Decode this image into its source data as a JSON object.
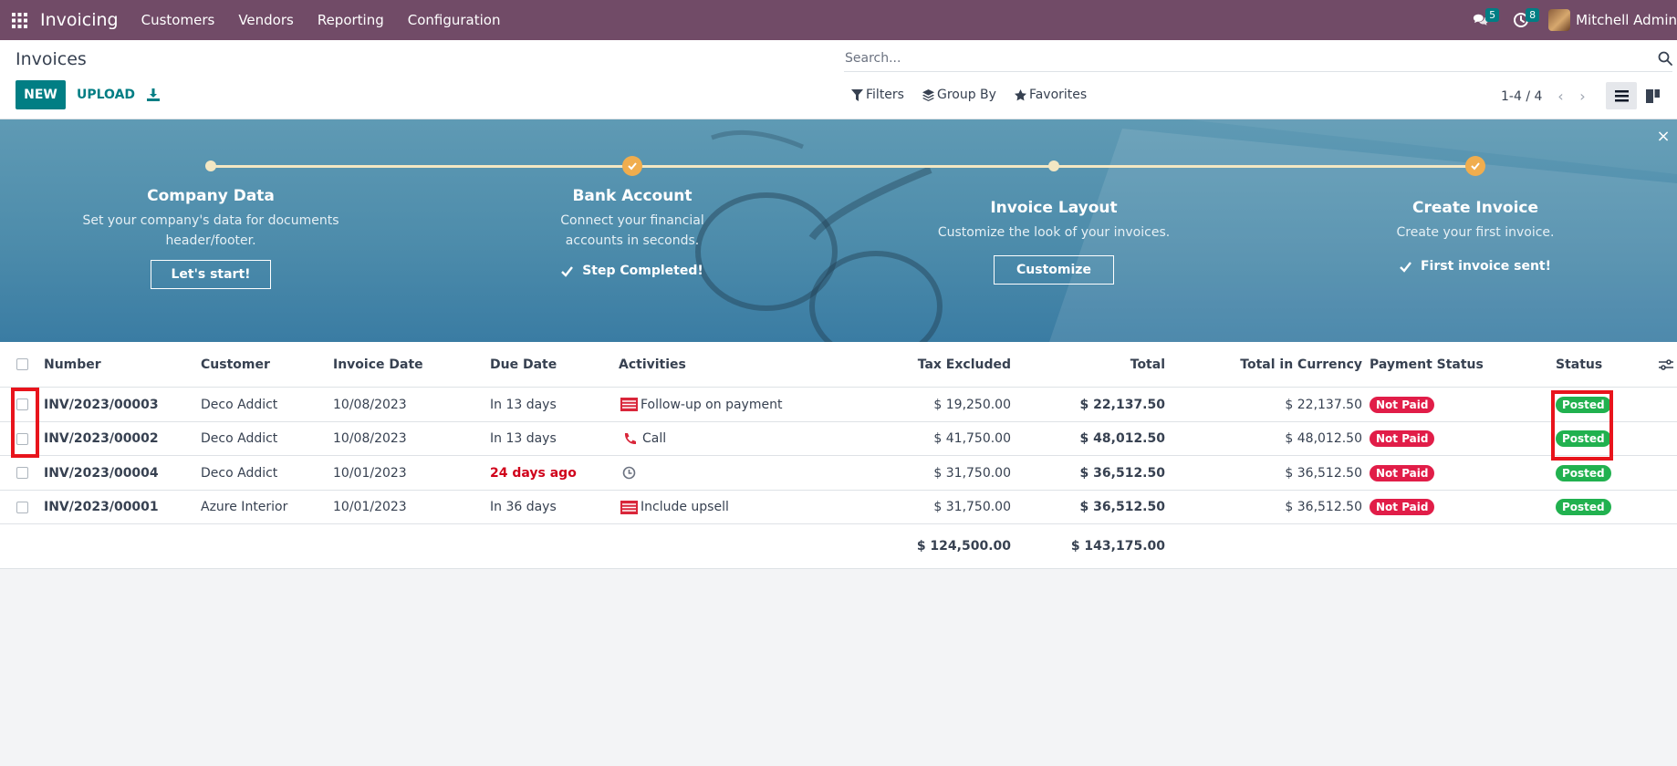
{
  "navbar": {
    "app_name": "Invoicing",
    "menu": [
      "Customers",
      "Vendors",
      "Reporting",
      "Configuration"
    ],
    "messages_count": "5",
    "activities_count": "8",
    "user_name": "Mitchell Admin"
  },
  "control": {
    "title": "Invoices",
    "new_label": "NEW",
    "upload_label": "UPLOAD",
    "search_placeholder": "Search...",
    "filters_label": "Filters",
    "groupby_label": "Group By",
    "favorites_label": "Favorites",
    "pager": "1-4 / 4"
  },
  "onboarding": {
    "close": "×",
    "steps": [
      {
        "title": "Company Data",
        "desc": "Set your company's data for documents header/footer.",
        "action": "Let's start!",
        "done": false
      },
      {
        "title": "Bank Account",
        "desc": "Connect your financial accounts in seconds.",
        "action": "Step Completed!",
        "done": true
      },
      {
        "title": "Invoice Layout",
        "desc": "Customize the look of your invoices.",
        "action": "Customize",
        "done": false
      },
      {
        "title": "Create Invoice",
        "desc": "Create your first invoice.",
        "action": "First invoice sent!",
        "done": true
      }
    ]
  },
  "table": {
    "columns": [
      "Number",
      "Customer",
      "Invoice Date",
      "Due Date",
      "Activities",
      "Tax Excluded",
      "Total",
      "Total in Currency",
      "Payment Status",
      "Status"
    ],
    "rows": [
      {
        "number": "INV/2023/00003",
        "customer": "Deco Addict",
        "invoice_date": "10/08/2023",
        "due_date": "In 13 days",
        "due_overdue": false,
        "activity_icon": "email-icon",
        "activity": "Follow-up on payment",
        "tax_excluded": "$ 19,250.00",
        "total": "$ 22,137.50",
        "total_currency": "$ 22,137.50",
        "payment_status": "Not Paid",
        "status": "Posted"
      },
      {
        "number": "INV/2023/00002",
        "customer": "Deco Addict",
        "invoice_date": "10/08/2023",
        "due_date": "In 13 days",
        "due_overdue": false,
        "activity_icon": "phone-icon",
        "activity": "Call",
        "tax_excluded": "$ 41,750.00",
        "total": "$ 48,012.50",
        "total_currency": "$ 48,012.50",
        "payment_status": "Not Paid",
        "status": "Posted"
      },
      {
        "number": "INV/2023/00004",
        "customer": "Deco Addict",
        "invoice_date": "10/01/2023",
        "due_date": "24 days ago",
        "due_overdue": true,
        "activity_icon": "clock-icon",
        "activity": "",
        "tax_excluded": "$ 31,750.00",
        "total": "$ 36,512.50",
        "total_currency": "$ 36,512.50",
        "payment_status": "Not Paid",
        "status": "Posted"
      },
      {
        "number": "INV/2023/00001",
        "customer": "Azure Interior",
        "invoice_date": "10/01/2023",
        "due_date": "In 36 days",
        "due_overdue": false,
        "activity_icon": "email-icon",
        "activity": "Include upsell",
        "tax_excluded": "$ 31,750.00",
        "total": "$ 36,512.50",
        "total_currency": "$ 36,512.50",
        "payment_status": "Not Paid",
        "status": "Posted"
      }
    ],
    "totals": {
      "tax_excluded": "$ 124,500.00",
      "total": "$ 143,175.00"
    }
  },
  "colors": {
    "brand": "#714B67",
    "primary": "#017E84",
    "not_paid": "#e11d48",
    "posted": "#21b14f",
    "highlight": "#e8141c"
  }
}
